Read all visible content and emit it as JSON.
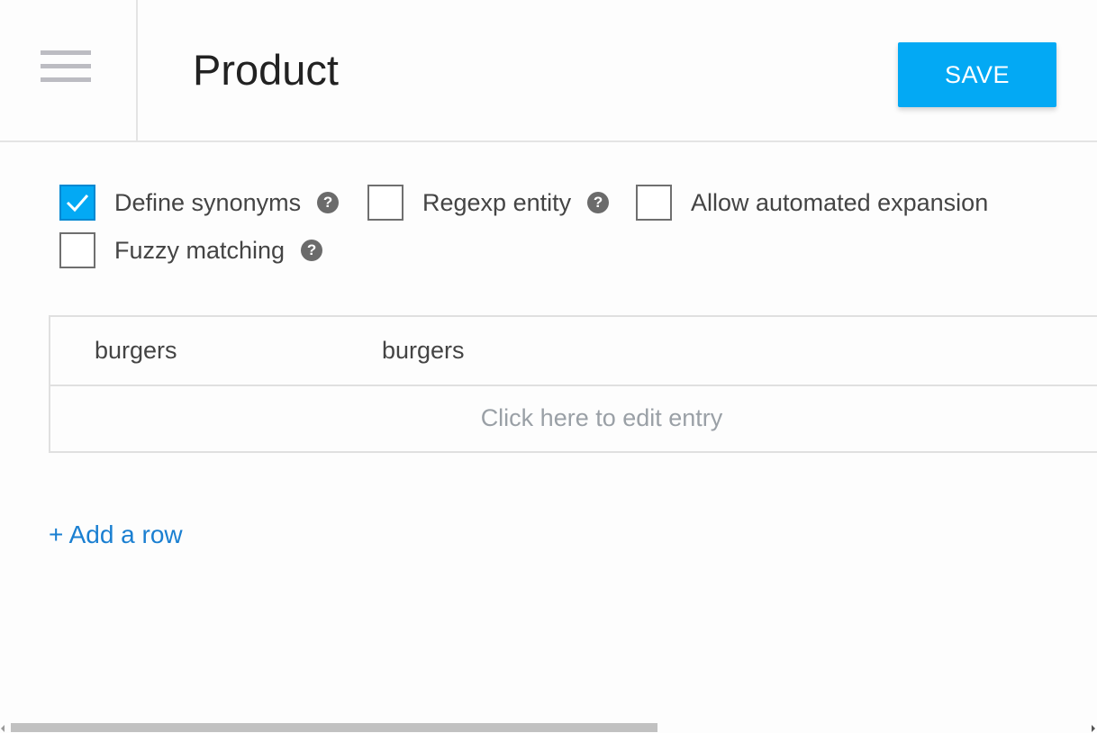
{
  "header": {
    "title": "Product",
    "save_label": "SAVE",
    "menu_icon": "hamburger-menu-icon"
  },
  "options": [
    {
      "label": "Define synonyms",
      "checked": true,
      "has_help": true
    },
    {
      "label": "Regexp entity",
      "checked": false,
      "has_help": true
    },
    {
      "label": "Allow automated expansion",
      "checked": false,
      "has_help": false
    },
    {
      "label": "Fuzzy matching",
      "checked": false,
      "has_help": true
    }
  ],
  "help_glyph": "?",
  "entries": [
    {
      "value": "burgers",
      "synonyms": "burgers"
    }
  ],
  "edit_hint": "Click here to edit entry",
  "add_row_label": "+ Add a row",
  "colors": {
    "accent": "#03a9f4",
    "link": "#1a7fd1"
  }
}
